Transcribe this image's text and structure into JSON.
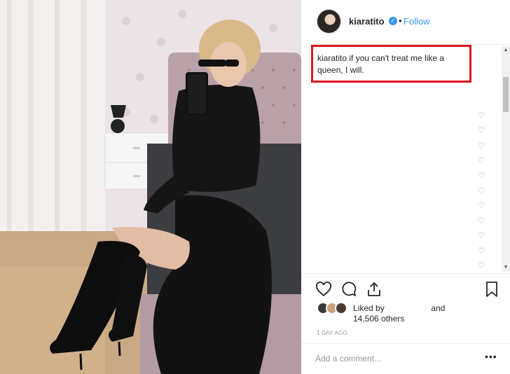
{
  "post": {
    "username": "kiaratito",
    "verified_icon": "✓",
    "separator": "•",
    "follow_label": "Follow",
    "caption_user": "kiaratito",
    "caption_text": " if you can't treat me like a queen, I will.",
    "comment_like_icon": "♡",
    "liked_by_prefix": "Liked by",
    "liked_by_suffix": "and",
    "likes_count": "14,506 others",
    "timestamp": "1 DAY AGO",
    "comment_placeholder": "Add a comment...",
    "more_options": "•••",
    "scroll_up": "▲",
    "scroll_down": "▼"
  },
  "colors": {
    "link": "#3897f0",
    "highlight_box": "#e0161e",
    "text": "#262626",
    "muted": "#999999"
  },
  "icons": [
    "heart-icon",
    "comment-icon",
    "share-icon",
    "bookmark-icon",
    "verified-icon",
    "more-icon"
  ]
}
